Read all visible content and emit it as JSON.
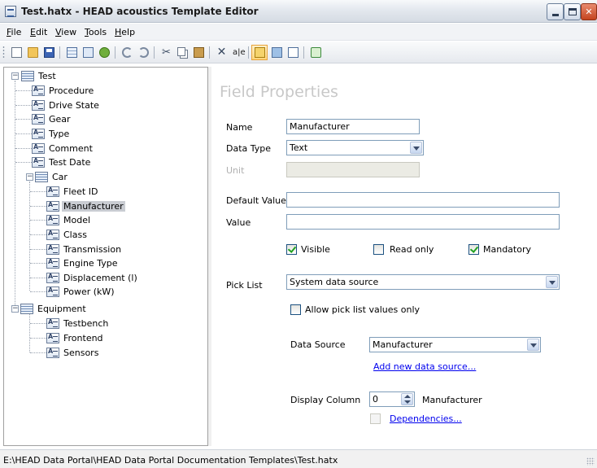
{
  "window": {
    "title": "Test.hatx - HEAD acoustics Template Editor"
  },
  "menu": [
    "File",
    "Edit",
    "View",
    "Tools",
    "Help"
  ],
  "toolbar": {
    "icons": [
      "new-icon",
      "open-icon",
      "save-icon",
      "grid-icon",
      "tree-icon",
      "add-icon",
      "undo-icon",
      "redo-icon",
      "cut-icon",
      "copy-icon",
      "paste-icon",
      "delete-icon",
      "spellcheck-icon",
      "properties-icon",
      "run-icon",
      "preview-icon",
      "refresh-icon"
    ],
    "spell_label": "a|e"
  },
  "tree": {
    "root": "Test",
    "items": [
      {
        "label": "Procedure"
      },
      {
        "label": "Drive State"
      },
      {
        "label": "Gear"
      },
      {
        "label": "Type"
      },
      {
        "label": "Comment"
      },
      {
        "label": "Test Date"
      },
      {
        "label": "Car"
      },
      {
        "label": "Fleet ID"
      },
      {
        "label": "Manufacturer",
        "selected": true
      },
      {
        "label": "Model"
      },
      {
        "label": "Class"
      },
      {
        "label": "Transmission"
      },
      {
        "label": "Engine Type"
      },
      {
        "label": "Displacement (l)"
      },
      {
        "label": "Power (kW)"
      },
      {
        "label": "Equipment"
      },
      {
        "label": "Testbench"
      },
      {
        "label": "Frontend"
      },
      {
        "label": "Sensors"
      }
    ]
  },
  "properties": {
    "title": "Field Properties",
    "name_label": "Name",
    "name_value": "Manufacturer",
    "data_type_label": "Data Type",
    "data_type_value": "Text",
    "unit_label": "Unit",
    "unit_value": "",
    "default_value_label": "Default Value",
    "default_value": "",
    "value_label": "Value",
    "value": "",
    "visible_label": "Visible",
    "visible_checked": true,
    "readonly_label": "Read only",
    "readonly_checked": false,
    "mandatory_label": "Mandatory",
    "mandatory_checked": true,
    "pick_list_label": "Pick List",
    "pick_list_value": "System data source",
    "allow_pick_label": "Allow pick list values only",
    "allow_pick_checked": false,
    "data_source_label": "Data Source",
    "data_source_value": "Manufacturer",
    "add_data_source_link": "Add new data source...",
    "display_column_label": "Display Column",
    "display_column_value": "0",
    "display_column_name": "Manufacturer",
    "dependencies_link": "Dependencies..."
  },
  "status": {
    "path": "E:\\HEAD Data Portal\\HEAD Data Portal Documentation Templates\\Test.hatx"
  }
}
